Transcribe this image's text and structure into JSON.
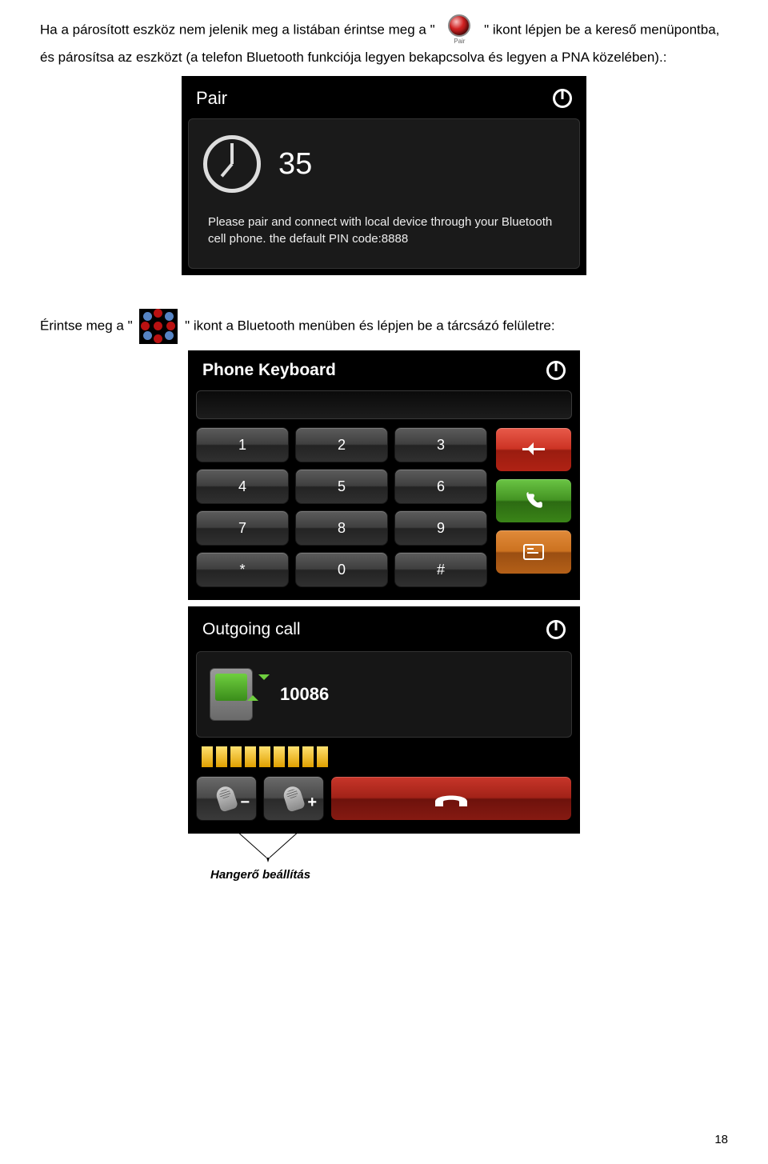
{
  "para1": {
    "before": "Ha a párosított eszköz nem jelenik meg a listában érintse meg a \"",
    "after": "\" ikont lépjen be a kereső menüpontba, és párosítsa az eszközt (a telefon Bluetooth funkciója legyen bekapcsolva és legyen a PNA közelében).:",
    "pair_label": "Pair"
  },
  "pair_shot": {
    "title": "Pair",
    "count": "35",
    "text": "Please pair and connect with local device through your Bluetooth cell phone. the default PIN code:8888"
  },
  "para2": {
    "before": "Érintse meg a \"",
    "after": "\" ikont a Bluetooth menüben és lépjen be a tárcsázó felületre:"
  },
  "kbd_shot": {
    "title": "Phone Keyboard",
    "keys": [
      "1",
      "2",
      "3",
      "4",
      "5",
      "6",
      "7",
      "8",
      "9",
      "*",
      "0",
      "#"
    ]
  },
  "out_shot": {
    "title": "Outgoing call",
    "number": "10086",
    "signal_bars": 9
  },
  "volume_label": "Hangerő beállítás",
  "page_number": "18"
}
